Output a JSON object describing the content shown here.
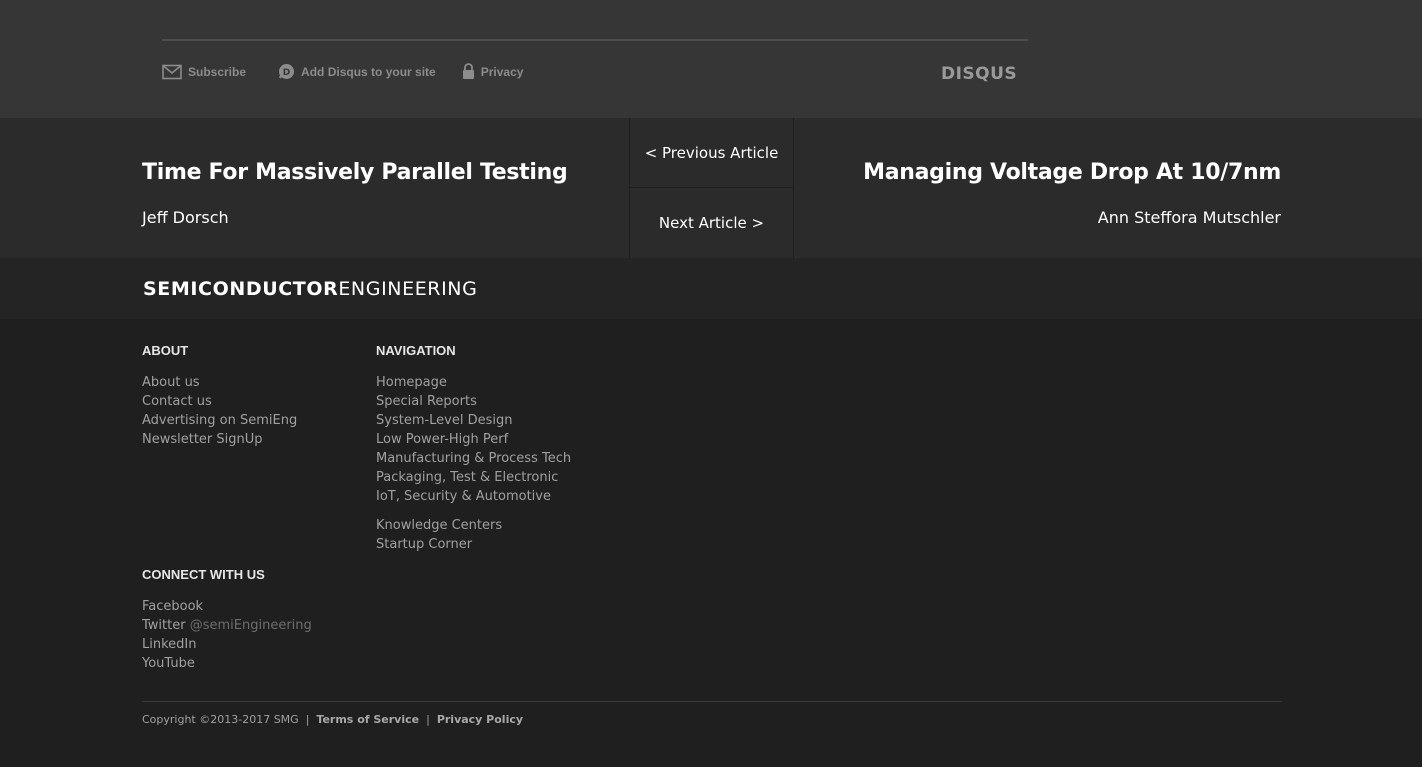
{
  "disqus": {
    "subscribe_label": "Subscribe",
    "add_disqus_label": "Add Disqus to your site",
    "privacy_label": "Privacy",
    "logo_text": "DISQUS"
  },
  "article_nav": {
    "previous": {
      "title": "Time For Massively Parallel Testing",
      "author": "Jeff Dorsch"
    },
    "next": {
      "title": "Managing Voltage Drop At 10/7nm",
      "author": "Ann Steffora Mutschler"
    },
    "prev_button_label": "< Previous Article",
    "next_button_label": "Next Article >"
  },
  "brand": {
    "bold_part": "SEMICONDUCTOR",
    "light_part": "ENGINEERING"
  },
  "footer": {
    "about": {
      "heading": "ABOUT",
      "items": [
        "About us",
        "Contact us",
        "Advertising on SemiEng",
        "Newsletter SignUp"
      ]
    },
    "navigation": {
      "heading": "NAVIGATION",
      "items": [
        "Homepage",
        "Special Reports",
        "System-Level Design",
        "Low Power-High Perf",
        "Manufacturing & Process Tech",
        "Packaging, Test & Electronic",
        "IoT, Security & Automotive"
      ],
      "extra_items": [
        "Knowledge Centers",
        "Startup Corner"
      ]
    },
    "connect": {
      "heading": "CONNECT WITH US",
      "facebook": "Facebook",
      "twitter": "Twitter",
      "twitter_handle": "@semiEngineering",
      "linkedin": "LinkedIn",
      "youtube": "YouTube"
    },
    "copyright": "Copyright ©2013-2017 SMG",
    "separator": "|",
    "terms_label": "Terms of Service",
    "privacy_policy_label": "Privacy Policy"
  }
}
